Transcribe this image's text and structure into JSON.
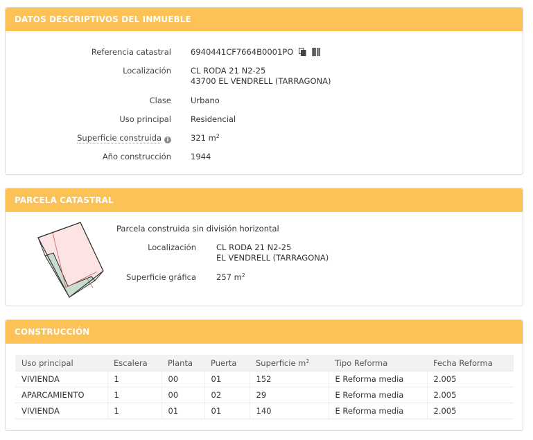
{
  "panel1": {
    "title": "DATOS DESCRIPTIVOS DEL INMUEBLE",
    "ref_label": "Referencia catastral",
    "ref_value": "6940441CF7664B0001PO",
    "loc_label": "Localización",
    "loc_line1": "CL RODA 21 N2-25",
    "loc_line2": "43700 EL VENDRELL (TARRAGONA)",
    "clase_label": "Clase",
    "clase_value": "Urbano",
    "uso_label": "Uso principal",
    "uso_value": "Residencial",
    "sup_label": "Superficie construida",
    "sup_value": "321 m",
    "sup_unit_exp": "2",
    "anio_label": "Año construcción",
    "anio_value": "1944"
  },
  "panel2": {
    "title": "PARCELA CATASTRAL",
    "desc": "Parcela construida sin división horizontal",
    "loc_label": "Localización",
    "loc_line1": "CL RODA 21 N2-25",
    "loc_line2": "EL VENDRELL (TARRAGONA)",
    "sup_label": "Superficie gráfica",
    "sup_value": "257 m",
    "sup_unit_exp": "2"
  },
  "panel3": {
    "title": "CONSTRUCCIÓN",
    "headers": [
      "Uso principal",
      "Escalera",
      "Planta",
      "Puerta",
      "Superficie m",
      "Tipo Reforma",
      "Fecha Reforma"
    ],
    "sup_header_exp": "2",
    "rows": [
      [
        "VIVIENDA",
        "1",
        "00",
        "01",
        "152",
        "E Reforma media",
        "2.005"
      ],
      [
        "APARCAMIENTO",
        "1",
        "00",
        "02",
        "29",
        "E Reforma media",
        "2.005"
      ],
      [
        "VIVIENDA",
        "1",
        "01",
        "01",
        "140",
        "E Reforma media",
        "2.005"
      ]
    ]
  },
  "colors": {
    "header_bg": "#fcc256",
    "parcel_built": "#fce4e4",
    "parcel_green": "#c8ddd0",
    "parcel_outline": "#333333"
  },
  "icons": [
    "copy-icon",
    "barcode-icon",
    "info-icon"
  ]
}
